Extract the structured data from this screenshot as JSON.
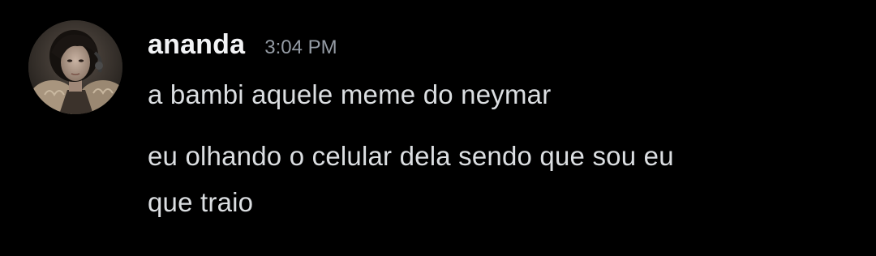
{
  "message": {
    "author": "ananda",
    "timestamp": "3:04 PM",
    "avatar_icon": "user-avatar-photo",
    "lines": [
      "a bambi aquele meme do neymar",
      "eu olhando o celular dela sendo que sou eu",
      "que traio"
    ]
  },
  "colors": {
    "background": "#000000",
    "username": "#f2f3f5",
    "timestamp": "#949ba4",
    "message_text": "#dbdee1"
  }
}
